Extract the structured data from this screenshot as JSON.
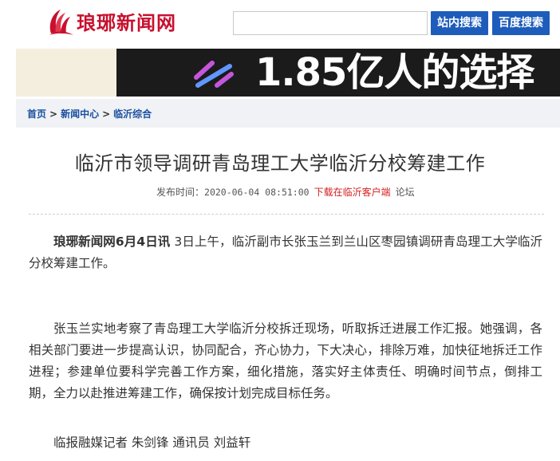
{
  "header": {
    "logo_text": "琅琊新闻网",
    "search_placeholder": "",
    "site_search_label": "站内搜索",
    "baidu_search_label": "百度搜索"
  },
  "banner": {
    "text": "1.85亿人的选择"
  },
  "breadcrumb": {
    "items": [
      "首页",
      "新闻中心",
      "临沂综合"
    ],
    "separator": ">"
  },
  "article": {
    "title": "临沂市领导调研青岛理工大学临沂分校筹建工作",
    "meta": {
      "published_label": "发布时间：",
      "published_time": "2020-06-04 08:51:00",
      "download_link": "下载在临沂客户端",
      "forum_link": "论坛"
    },
    "lead_source": "琅琊新闻网6月4日讯",
    "para1": "3日上午，临沂副市长张玉兰到兰山区枣园镇调研青岛理工大学临沂分校筹建工作。",
    "para2": "张玉兰实地考察了青岛理工大学临沂分校拆迁现场，听取拆迁进展工作汇报。她强调，各相关部门要进一步提高认识，协同配合，齐心协力，下大决心，排除万难，加快征地拆迁工作进程；参建单位要科学完善工作方案，细化措施，落实好主体责任、明确时间节点，倒排工期，全力以赴推进筹建工作，确保按计划完成目标任务。",
    "byline": "临报融媒记者 朱剑锋 通讯员 刘益轩"
  },
  "colors": {
    "brand_red": "#c8102e",
    "button_blue": "#1e5cbb",
    "link_blue": "#1a4fa0",
    "download_red": "#d42020"
  }
}
